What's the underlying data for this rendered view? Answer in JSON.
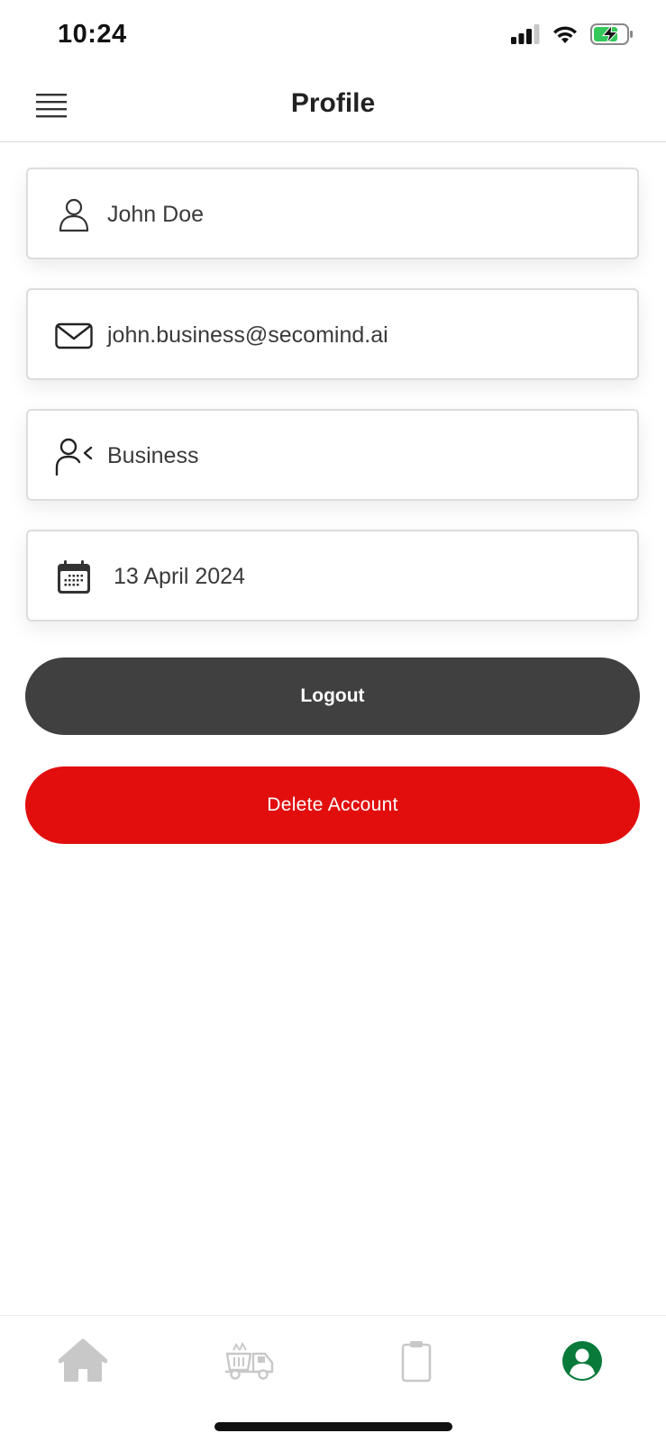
{
  "status_bar": {
    "time": "10:24",
    "battery": "charging",
    "battery_color": "#34c759"
  },
  "header": {
    "title": "Profile"
  },
  "profile": {
    "name": "John Doe",
    "email": "john.business@secomind.ai",
    "account_type": "Business",
    "date": "13 April 2024"
  },
  "actions": {
    "logout_label": "Logout",
    "delete_label": "Delete Account",
    "logout_color": "#404040",
    "delete_color": "#e20e0e"
  },
  "tab_bar": {
    "tabs": [
      {
        "icon": "home-icon",
        "active": false
      },
      {
        "icon": "skip-truck-icon",
        "active": false
      },
      {
        "icon": "clipboard-icon",
        "active": false
      },
      {
        "icon": "profile-icon",
        "active": true
      }
    ],
    "active_color": "#0a7a3a",
    "inactive_color": "#c8c8c8"
  }
}
